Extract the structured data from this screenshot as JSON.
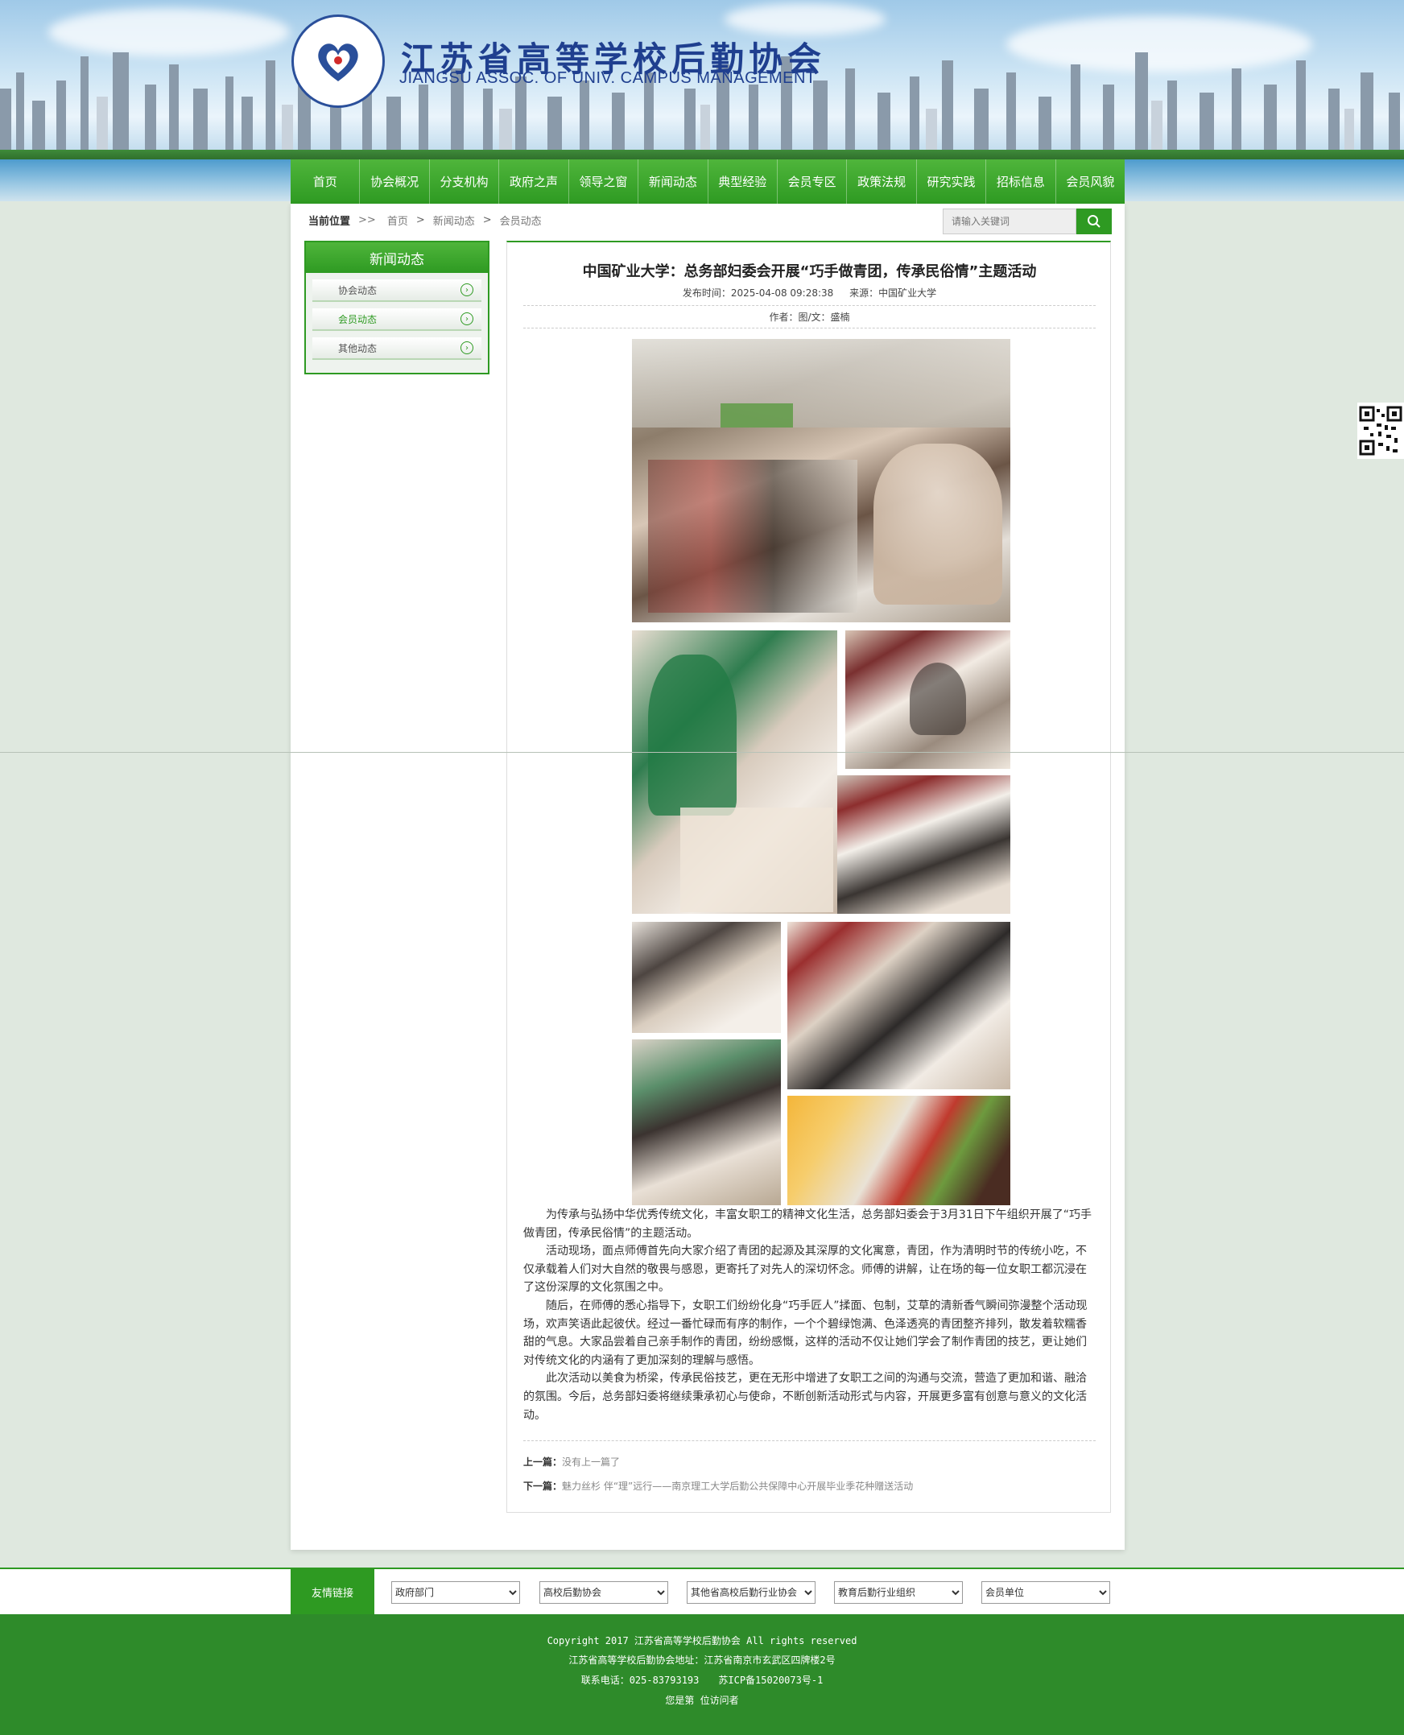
{
  "header": {
    "title_cn": "江苏省高等学校后勤协会",
    "title_en": "JIANGSU ASSOC. OF UNIV. CAMPUS MANAGEMENT"
  },
  "nav": [
    "首页",
    "协会概况",
    "分支机构",
    "政府之声",
    "领导之窗",
    "新闻动态",
    "典型经验",
    "会员专区",
    "政策法规",
    "研究实践",
    "招标信息",
    "会员风貌"
  ],
  "breadcrumb": {
    "label": "当前位置",
    "sep0": ">>",
    "items": [
      "首页",
      "新闻动态",
      "会员动态"
    ],
    "sep": ">"
  },
  "search": {
    "placeholder": "请输入关键词"
  },
  "sidebar": {
    "title": "新闻动态",
    "items": [
      {
        "label": "协会动态"
      },
      {
        "label": "会员动态"
      },
      {
        "label": "其他动态"
      }
    ]
  },
  "article": {
    "title": "中国矿业大学：总务部妇委会开展“巧手做青团，传承民俗情”主题活动",
    "publish": "发布时间：2025-04-08 09:28:38",
    "source": "来源：中国矿业大学",
    "author": "作者：图/文：盛楠",
    "paragraphs": [
      "为传承与弘扬中华优秀传统文化，丰富女职工的精神文化生活，总务部妇委会于3月31日下午组织开展了“巧手做青团，传承民俗情”的主题活动。",
      "活动现场，面点师傅首先向大家介绍了青团的起源及其深厚的文化寓意，青团，作为清明时节的传统小吃，不仅承载着人们对大自然的敬畏与感恩，更寄托了对先人的深切怀念。师傅的讲解，让在场的每一位女职工都沉浸在了这份深厚的文化氛围之中。",
      "随后，在师傅的悉心指导下，女职工们纷纷化身“巧手匠人”揉面、包制，艾草的清新香气瞬间弥漫整个活动现场，欢声笑语此起彼伏。经过一番忙碌而有序的制作，一个个碧绿饱满、色泽透亮的青团整齐排列，散发着软糯香甜的气息。大家品尝着自己亲手制作的青团，纷纷感慨，这样的活动不仅让她们学会了制作青团的技艺，更让她们对传统文化的内涵有了更加深刻的理解与感悟。",
      "此次活动以美食为桥梁，传承民俗技艺，更在无形中增进了女职工之间的沟通与交流，营造了更加和谐、融洽的氛围。今后，总务部妇委将继续秉承初心与使命，不断创新活动形式与内容，开展更多富有创意与意义的文化活动。"
    ],
    "prev_label": "上一篇：",
    "prev_text": "没有上一篇了",
    "next_label": "下一篇：",
    "next_text": "魅力丝杉 伴“理”远行——南京理工大学后勤公共保障中心开展毕业季花种赠送活动"
  },
  "links": {
    "label": "友情链接",
    "selects": [
      "政府部门",
      "高校后勤协会",
      "其他省高校后勤行业协会",
      "教育后勤行业组织",
      "会员单位"
    ]
  },
  "footer": {
    "line1": "Copyright 2017 江苏省高等学校后勤协会 All rights reserved",
    "line2": "江苏省高等学校后勤协会地址：江苏省南京市玄武区四牌楼2号",
    "line3": "联系电话：025-83793193　　苏ICP备15020073号-1",
    "line4": "您是第  位访问者"
  },
  "colors": {
    "brand_green": "#2e9a22",
    "footer_green": "#2e8b2a",
    "logo_blue": "#1f3f8f"
  }
}
